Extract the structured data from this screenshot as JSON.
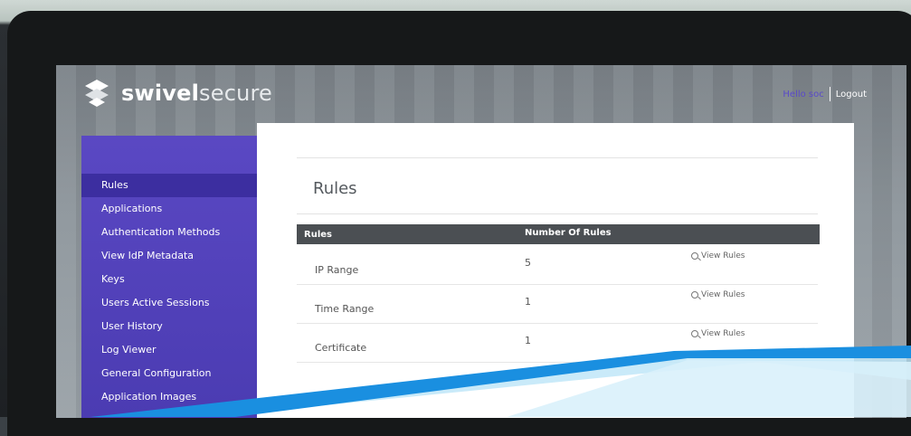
{
  "header": {
    "brand_bold": "swivel",
    "brand_light": "secure",
    "greeting": "Hello soc",
    "logout_label": "Logout"
  },
  "sidebar": {
    "items": [
      {
        "label": "Rules",
        "active": true
      },
      {
        "label": "Applications"
      },
      {
        "label": "Authentication Methods"
      },
      {
        "label": "View IdP Metadata"
      },
      {
        "label": "Keys"
      },
      {
        "label": "Users Active Sessions"
      },
      {
        "label": "User History"
      },
      {
        "label": "Log Viewer"
      },
      {
        "label": "General Configuration"
      },
      {
        "label": "Application Images"
      }
    ]
  },
  "main": {
    "title": "Rules",
    "table": {
      "columns": [
        "Rules",
        "Number Of Rules"
      ],
      "action_label": "View Rules",
      "rows": [
        {
          "name": "IP Range",
          "count": "5"
        },
        {
          "name": "Time Range",
          "count": "1"
        },
        {
          "name": "Certificate",
          "count": "1"
        }
      ]
    }
  },
  "colors": {
    "sidebar": "#4a3bb1",
    "sidebar_active": "#3c2ea0",
    "table_header": "#4b4f53",
    "greeting": "#5a4ac9",
    "swoosh": "#1a8fe0"
  },
  "icons": [
    "swivel-logo-icon",
    "search-icon"
  ]
}
